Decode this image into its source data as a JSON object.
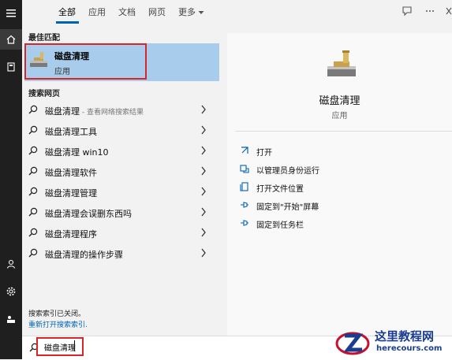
{
  "tabs": [
    {
      "label": "全部",
      "active": true
    },
    {
      "label": "应用"
    },
    {
      "label": "文档"
    },
    {
      "label": "网页"
    },
    {
      "label": "更多"
    }
  ],
  "best_match": {
    "section_label": "最佳匹配",
    "title": "磁盘清理",
    "subtitle": "应用"
  },
  "web": {
    "section_label": "搜索网页",
    "items": [
      {
        "text": "磁盘清理",
        "hint": " - 查看网络搜索结果"
      },
      {
        "text": "磁盘清理工具"
      },
      {
        "text": "磁盘清理 win10"
      },
      {
        "text": "磁盘清理软件"
      },
      {
        "text": "磁盘清理管理"
      },
      {
        "text": "磁盘清理会误删东西吗"
      },
      {
        "text": "磁盘清理程序"
      },
      {
        "text": "磁盘清理的操作步骤"
      }
    ]
  },
  "footer": {
    "notice": "搜索索引已关闭。",
    "link": "重新打开搜索索引."
  },
  "preview": {
    "title": "磁盘清理",
    "subtitle": "应用",
    "actions": [
      {
        "label": "打开",
        "icon": "open-icon"
      },
      {
        "label": "以管理员身份运行",
        "icon": "run-as-admin-icon"
      },
      {
        "label": "打开文件位置",
        "icon": "file-location-icon"
      },
      {
        "label": "固定到\"开始\"屏幕",
        "icon": "pin-start-icon"
      },
      {
        "label": "固定到任务栏",
        "icon": "pin-taskbar-icon"
      }
    ]
  },
  "search": {
    "value": "磁盘清理"
  },
  "watermark": {
    "name": "这里教程网",
    "url": "herecours.com"
  },
  "colors": {
    "accent": "#0063b1",
    "selection": "#a8cdec",
    "highlight_box": "#d8252a"
  }
}
